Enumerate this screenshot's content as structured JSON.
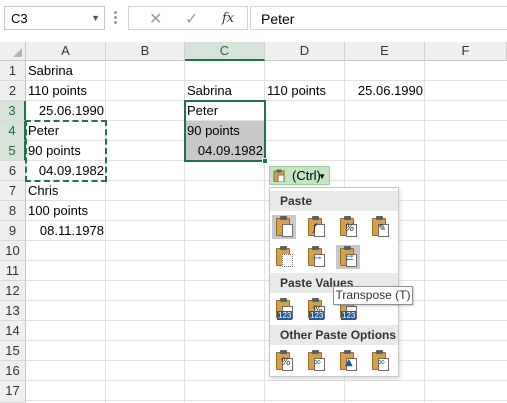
{
  "formula_bar": {
    "name_box": "C3",
    "cancel_icon": "close-icon",
    "enter_icon": "check-icon",
    "fx_label": "fx",
    "value": "Peter"
  },
  "columns": [
    "A",
    "B",
    "C",
    "D",
    "E",
    "F"
  ],
  "rows": [
    "1",
    "2",
    "3",
    "4",
    "5",
    "6",
    "7",
    "8",
    "9",
    "10",
    "11",
    "12",
    "13",
    "14",
    "15",
    "16",
    "17"
  ],
  "cells": {
    "A1": "Sabrina",
    "A2": "110 points",
    "A3": "25.06.1990",
    "A4": "Peter",
    "A5": "90 points",
    "A6": "04.09.1982",
    "A7": "Chris",
    "A8": "100 points",
    "A9": "08.11.1978",
    "C2": "Sabrina",
    "D2": "110 points",
    "E2": "25.06.1990",
    "C3": "Peter",
    "C4": "90 points",
    "C5": "04.09.1982"
  },
  "paste_options": {
    "button_label": "(Ctrl)",
    "sections": {
      "paste": "Paste",
      "paste_values": "Paste Values",
      "other": "Other Paste Options"
    },
    "tooltip": "Transpose (T)",
    "icons": {
      "paste": [
        "paste-icon",
        "formulas-icon",
        "formulas-number-formatting-icon",
        "keep-source-formatting-icon",
        "no-borders-icon",
        "keep-column-widths-icon",
        "transpose-icon"
      ],
      "values": [
        "values-icon",
        "values-number-formatting-icon",
        "values-source-formatting-icon"
      ],
      "other": [
        "formatting-icon",
        "paste-link-icon",
        "picture-icon",
        "linked-picture-icon"
      ]
    },
    "highlight_color": "#c8c8c8"
  },
  "colors": {
    "accent": "#217346",
    "ctrl_button": "#c3e5c4"
  }
}
